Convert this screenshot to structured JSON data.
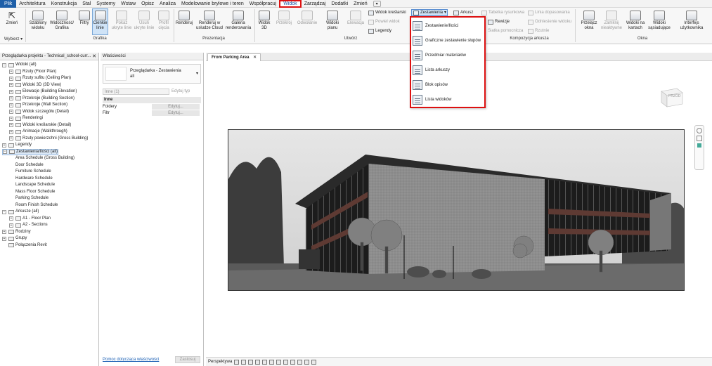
{
  "menu": {
    "file": "Plik",
    "items": [
      "Architektura",
      "Konstrukcja",
      "Stal",
      "Systemy",
      "Wstaw",
      "Opisz",
      "Analiza",
      "Modelowanie bryłowe i teren",
      "Współpracuj"
    ],
    "active": "Widok",
    "items_after": [
      "Zarządzaj",
      "Dodatki",
      "Zmień"
    ],
    "context": "▾"
  },
  "ribbon": {
    "wybierz": {
      "modify": "Zmień",
      "label": "Wybierz ▾"
    },
    "grafika": {
      "label": "Grafika",
      "buttons": [
        "Szablony widoku",
        "Widoczność/ Grafika",
        "Filtry",
        "Cienkie linie",
        "Pokaż ukryte linie",
        "Usuń ukryte linie",
        "Profil cięcia"
      ]
    },
    "prezentacja": {
      "label": "Prezentacja",
      "buttons": [
        "Renderuj",
        "Renderuj w usłudze Cloud",
        "Galeria renderowania"
      ]
    },
    "utworz": {
      "label": "Utwórz",
      "buttons": [
        "Widok 3D",
        "Przekrój",
        "Odwołanie",
        "Widoki planu",
        "Elewacja"
      ],
      "small": {
        "powiel": "Powiel widok",
        "legendy": "Legendy",
        "kreslarski": "Widok kreślarski",
        "zestawienia": "Zestawienia"
      }
    },
    "kompozycja": {
      "label": "Kompozycja arkusza",
      "items": [
        "Arkusz",
        "Tabelka rysunkowa",
        "Linia dopasowania",
        "Rewizje",
        "Odniesienie widoku",
        "Siatka pomocnicza",
        "Rzutnie"
      ]
    },
    "okna": {
      "label": "Okna",
      "buttons": [
        "Przełącz okna",
        "Zamknij nieaktywne",
        "Widoki na kartach",
        "Widoki sąsiadujące",
        "Interfejs użytkownika"
      ]
    }
  },
  "dropdown": {
    "items": [
      "Zestawienie/Ilości",
      "Graficzne zestawienie słupów",
      "Przedmiar materiałów",
      "Lista arkuszy",
      "Blok opisów",
      "Lista widoków"
    ]
  },
  "browser": {
    "title": "Przeglądarka projektu - Technical_school-curr...",
    "close": "✕",
    "tree": [
      {
        "label": "Widoki (all)",
        "level": 0,
        "toggle": "−"
      },
      {
        "label": "Rzuty (Floor Plan)",
        "level": 1,
        "toggle": "+"
      },
      {
        "label": "Rzuty sufitu (Ceiling Plan)",
        "level": 1,
        "toggle": "+"
      },
      {
        "label": "Widoki 3D (3D View)",
        "level": 1,
        "toggle": "+"
      },
      {
        "label": "Elewacje (Building Elevation)",
        "level": 1,
        "toggle": "+"
      },
      {
        "label": "Przekroje (Building Section)",
        "level": 1,
        "toggle": "+"
      },
      {
        "label": "Przekroje (Wall Section)",
        "level": 1,
        "toggle": "+"
      },
      {
        "label": "Widok szczegółu (Detail)",
        "level": 1,
        "toggle": "+"
      },
      {
        "label": "Renderingi",
        "level": 1,
        "toggle": "+"
      },
      {
        "label": "Widoki kreślarskie (Detail)",
        "level": 1,
        "toggle": "+"
      },
      {
        "label": "Animacje (Walkthrough)",
        "level": 1,
        "toggle": "+"
      },
      {
        "label": "Rzuty powierzchni (Gross Building)",
        "level": 1,
        "toggle": "+"
      },
      {
        "label": "Legendy",
        "level": 0,
        "toggle": "+"
      },
      {
        "label": "Zestawienia/Ilości (all)",
        "level": 0,
        "toggle": "−",
        "selected": true
      },
      {
        "label": "Area Schedule (Gross Building)",
        "level": 2,
        "toggle": ""
      },
      {
        "label": "Door Schedule",
        "level": 2,
        "toggle": ""
      },
      {
        "label": "Furniture Schedule",
        "level": 2,
        "toggle": ""
      },
      {
        "label": "Hardware Schedule",
        "level": 2,
        "toggle": ""
      },
      {
        "label": "Landscape Schedule",
        "level": 2,
        "toggle": ""
      },
      {
        "label": "Mass Floor Schedule",
        "level": 2,
        "toggle": ""
      },
      {
        "label": "Parking Schedule",
        "level": 2,
        "toggle": ""
      },
      {
        "label": "Room Finish Schedule",
        "level": 2,
        "toggle": ""
      },
      {
        "label": "Arkusze (all)",
        "level": 0,
        "toggle": "−"
      },
      {
        "label": "A1 - Floor Plan",
        "level": 1,
        "toggle": "+"
      },
      {
        "label": "A2 - Sections",
        "level": 1,
        "toggle": "+"
      },
      {
        "label": "Rodziny",
        "level": 0,
        "toggle": "+"
      },
      {
        "label": "Grupy",
        "level": 0,
        "toggle": "+"
      },
      {
        "label": "Połączenia Revit",
        "level": 0,
        "toggle": ""
      }
    ]
  },
  "properties": {
    "title": "Właściwości",
    "type_name": "Przeglądarka - Zestawienia",
    "type_sub": "all",
    "filter_value": "Inne (1)",
    "edit_type": "Edytuj typ",
    "section": "Inne",
    "rows": [
      {
        "name": "Foldery",
        "value": "Edytuj..."
      },
      {
        "name": "Filtr",
        "value": "Edytuj..."
      }
    ],
    "help_link": "Pomoc dotycząca właściwości",
    "apply": "Zastosuj"
  },
  "view": {
    "tab": "From Parking Area",
    "tab_close": "✕",
    "viewcube": "PRZÓD",
    "status": "Perspektywa"
  }
}
